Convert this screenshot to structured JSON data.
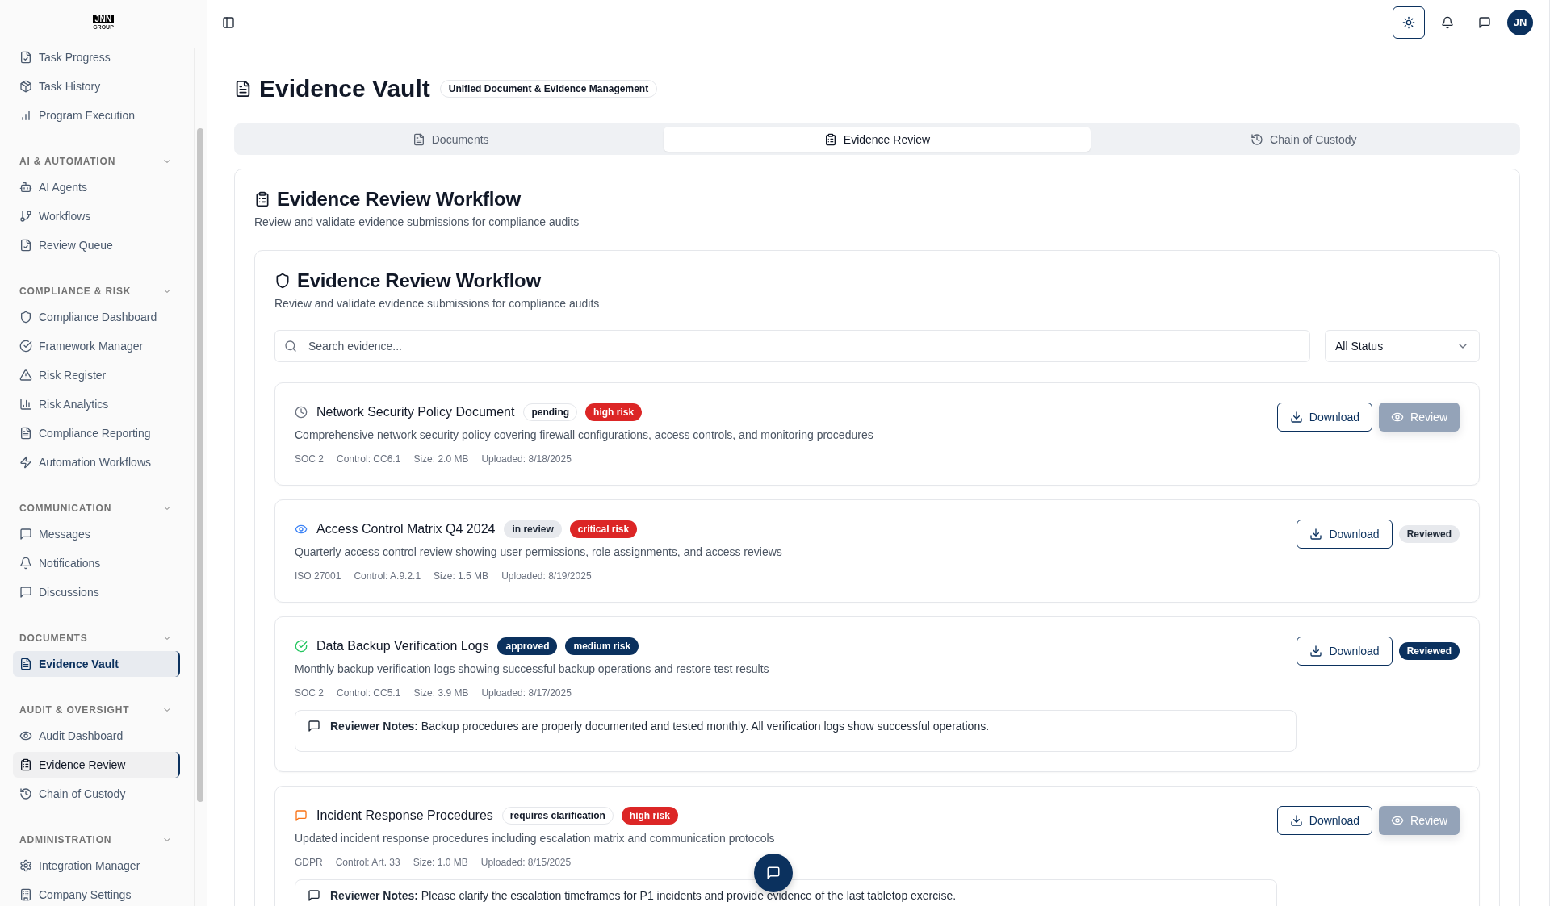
{
  "sidebar": {
    "logo": {
      "mark": "JNN",
      "caption": "GROUP"
    },
    "groups": [
      {
        "items": [
          {
            "label": "Task Progress",
            "selected": false,
            "hovered": false
          },
          {
            "label": "Task History",
            "selected": false,
            "hovered": false
          },
          {
            "label": "Program Execution",
            "selected": false,
            "hovered": false
          }
        ]
      },
      {
        "heading": "AI & AUTOMATION",
        "expanded": true,
        "items": [
          {
            "label": "AI Agents",
            "selected": false,
            "hovered": false
          },
          {
            "label": "Workflows",
            "selected": false,
            "hovered": false
          },
          {
            "label": "Review Queue",
            "selected": false,
            "hovered": false
          }
        ]
      },
      {
        "heading": "COMPLIANCE & RISK",
        "expanded": true,
        "items": [
          {
            "label": "Compliance Dashboard",
            "selected": false,
            "hovered": false
          },
          {
            "label": "Framework Manager",
            "selected": false,
            "hovered": false
          },
          {
            "label": "Risk Register",
            "selected": false,
            "hovered": false
          },
          {
            "label": "Risk Analytics",
            "selected": false,
            "hovered": false
          },
          {
            "label": "Compliance Reporting",
            "selected": false,
            "hovered": false
          },
          {
            "label": "Automation Workflows",
            "selected": false,
            "hovered": false
          }
        ]
      },
      {
        "heading": "COMMUNICATION",
        "expanded": true,
        "items": [
          {
            "label": "Messages",
            "selected": false,
            "hovered": false
          },
          {
            "label": "Notifications",
            "selected": false,
            "hovered": false
          },
          {
            "label": "Discussions",
            "selected": false,
            "hovered": false
          }
        ]
      },
      {
        "heading": "DOCUMENTS",
        "expanded": true,
        "items": [
          {
            "label": "Evidence Vault",
            "selected": true,
            "hovered": false
          }
        ]
      },
      {
        "heading": "AUDIT & OVERSIGHT",
        "expanded": true,
        "items": [
          {
            "label": "Audit Dashboard",
            "selected": false,
            "hovered": false
          },
          {
            "label": "Evidence Review",
            "selected": false,
            "hovered": true
          },
          {
            "label": "Chain of Custody",
            "selected": false,
            "hovered": false
          }
        ]
      },
      {
        "heading": "ADMINISTRATION",
        "expanded": true,
        "items": [
          {
            "label": "Integration Manager",
            "selected": false,
            "hovered": false
          },
          {
            "label": "Company Settings",
            "selected": false,
            "hovered": false
          }
        ]
      }
    ]
  },
  "top_bar": {
    "avatar": "JN"
  },
  "page": {
    "title": "Evidence Vault",
    "badge": "Unified Document & Evidence Management",
    "tabs": [
      {
        "label": "Documents",
        "selected": false
      },
      {
        "label": "Evidence Review",
        "selected": true
      },
      {
        "label": "Chain of Custody",
        "selected": false
      }
    ]
  },
  "panel": {
    "title": "Evidence Review Workflow",
    "subtitle": "Review and validate evidence submissions for compliance audits",
    "workflow": {
      "title": "Evidence Review Workflow",
      "subtitle": "Review and validate evidence submissions for compliance audits",
      "search": {
        "placeholder": "Search evidence..."
      },
      "status_filter": {
        "value": "All Status"
      },
      "items": [
        {
          "kind": "pending",
          "title": "Network Security Policy Document",
          "status": "pending",
          "risk": {
            "label": "high risk",
            "color": "#dc2626"
          },
          "description": "Comprehensive network security policy covering firewall configurations, access controls, and monitoring procedures",
          "meta": [
            "SOC 2",
            "Control: CC6.1",
            "Size: 2.0 MB",
            "Uploaded: 8/18/2025"
          ],
          "download": "Download",
          "action": {
            "kind": "button",
            "label": "Review",
            "disabled": true
          }
        },
        {
          "kind": "in-review",
          "title": "Access Control Matrix Q4 2024",
          "status": "in review",
          "risk": {
            "label": "critical risk",
            "color": "#dc2626"
          },
          "description": "Quarterly access control review showing user permissions, role assignments, and access reviews",
          "meta": [
            "ISO 27001",
            "Control: A.9.2.1",
            "Size: 1.5 MB",
            "Uploaded: 8/19/2025"
          ],
          "download": "Download",
          "action": {
            "kind": "badge",
            "label": "Reviewed",
            "highlighted": false
          }
        },
        {
          "kind": "approved",
          "title": "Data Backup Verification Logs",
          "status": "approved",
          "risk": {
            "label": "medium risk",
            "color": "#0b315e"
          },
          "description": "Monthly backup verification logs showing successful backup operations and restore test results",
          "meta": [
            "SOC 2",
            "Control: CC5.1",
            "Size: 3.9 MB",
            "Uploaded: 8/17/2025"
          ],
          "notes": "**Reviewer Notes:** Backup procedures are properly documented and tested monthly. All verification logs show successful operations.",
          "download": "Download",
          "action": {
            "kind": "badge",
            "label": "Reviewed",
            "highlighted": true
          }
        },
        {
          "kind": "clarification",
          "title": "Incident Response Procedures",
          "status": "requires clarification",
          "risk": {
            "label": "high risk",
            "color": "#dc2626"
          },
          "description": "Updated incident response procedures including escalation matrix and communication protocols",
          "meta": [
            "GDPR",
            "Control: Art. 33",
            "Size: 1.0 MB",
            "Uploaded: 8/15/2025"
          ],
          "notes": "**Reviewer Notes:** Please clarify the escalation timeframes for P1 incidents and provide evidence of the last tabletop exercise.",
          "download": "Download",
          "action": {
            "kind": "button",
            "label": "Review",
            "disabled": true
          }
        }
      ]
    }
  }
}
